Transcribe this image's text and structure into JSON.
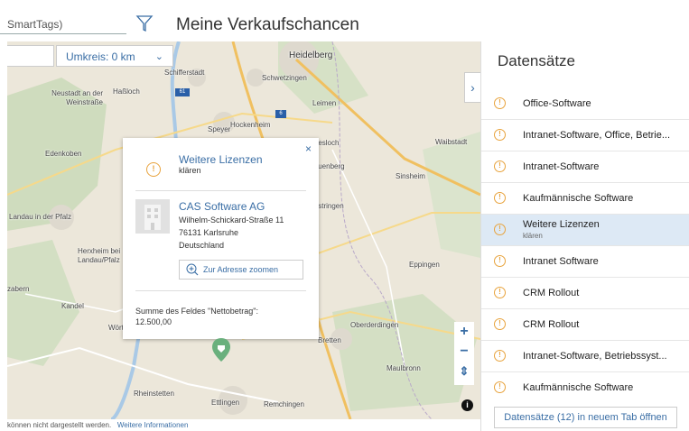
{
  "topbar": {
    "search_value": "SmartTags)",
    "title": "Meine Verkaufschancen",
    "filter_icon": "funnel-icon"
  },
  "map": {
    "radius_value": "",
    "radius_label": "Umkreis: 0 km",
    "places": [
      "Heidelberg",
      "Schifferstadt",
      "Schwetzingen",
      "Neustadt an der Weinstraße",
      "Haßloch",
      "Leimen",
      "Speyer",
      "Hockenheim",
      "Edenkoben",
      "Wiesloch",
      "Waibstadt",
      "Rauenberg",
      "Sinsheim",
      "Landau in der Pfalz",
      "Östringen",
      "Herxheim bei Landau/Pfalz",
      "Eppingen",
      "zabern",
      "Kandel",
      "Wört",
      "Oberderdingen",
      "Bretten",
      "Maulbronn",
      "Rheinstetten",
      "Ettlingen",
      "Remchingen"
    ],
    "road_labels": [
      "61",
      "6"
    ],
    "attribution_text": "können nicht dargestellt werden.",
    "attribution_link": "Weitere Informationen"
  },
  "popup": {
    "close": "×",
    "title": "Weitere Lizenzen",
    "subtitle": "klären",
    "badge": "!",
    "company": "CAS Software AG",
    "street": "Wilhelm-Schickard-Straße 11",
    "city": "76131 Karlsruhe",
    "country": "Deutschland",
    "zoom_button": "Zur Adresse zoomen",
    "sum_label": "Summe des Feldes \"Nettobetrag\":",
    "sum_value": "12.500,00"
  },
  "zoom": {
    "in": "+",
    "out": "−",
    "pan": "⇕"
  },
  "side": {
    "title": "Datensätze",
    "records": [
      {
        "title": "Office-Software",
        "sub": ""
      },
      {
        "title": "Intranet-Software, Office, Betrie...",
        "sub": ""
      },
      {
        "title": "Intranet-Software",
        "sub": ""
      },
      {
        "title": "Kaufmännische Software",
        "sub": ""
      },
      {
        "title": "Weitere Lizenzen",
        "sub": "klären"
      },
      {
        "title": "Intranet Software",
        "sub": ""
      },
      {
        "title": "CRM Rollout",
        "sub": ""
      },
      {
        "title": "CRM Rollout",
        "sub": ""
      },
      {
        "title": "Intranet-Software, Betriebssyst...",
        "sub": ""
      },
      {
        "title": "Kaufmännische Software",
        "sub": ""
      }
    ],
    "open_tab_button": "Datensätze (12) in neuem Tab öffnen"
  },
  "colors": {
    "accent": "#3a6ea5",
    "badge": "#e8a33d",
    "selected": "#dde9f5"
  }
}
